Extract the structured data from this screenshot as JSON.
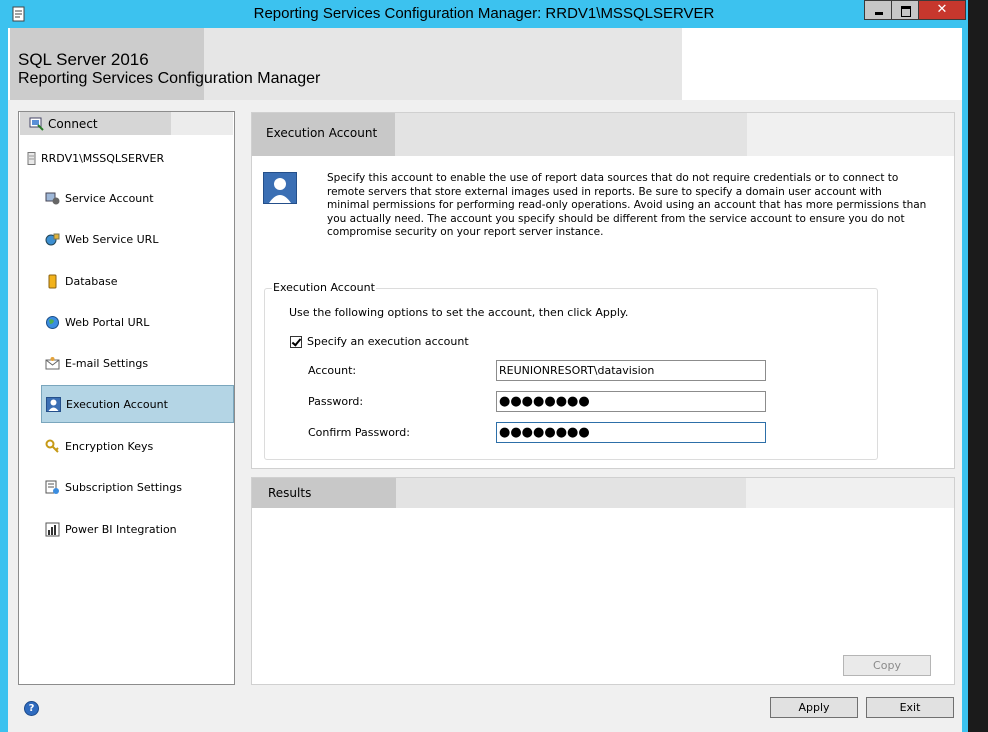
{
  "window": {
    "title": "Reporting Services Configuration Manager: RRDV1\\MSSQLSERVER",
    "close_label": "✕"
  },
  "banner": {
    "product": "SQL Server 2016",
    "app_name": "Reporting Services Configuration Manager"
  },
  "nav": {
    "connect_label": "Connect",
    "server": "RRDV1\\MSSQLSERVER",
    "items": [
      {
        "label": "Service Account",
        "icon": "service-account-icon"
      },
      {
        "label": "Web Service URL",
        "icon": "web-service-icon"
      },
      {
        "label": "Database",
        "icon": "database-icon"
      },
      {
        "label": "Web Portal URL",
        "icon": "globe-icon"
      },
      {
        "label": "E-mail Settings",
        "icon": "email-icon"
      },
      {
        "label": "Execution Account",
        "icon": "user-icon",
        "selected": true
      },
      {
        "label": "Encryption Keys",
        "icon": "key-icon"
      },
      {
        "label": "Subscription Settings",
        "icon": "subscription-icon"
      },
      {
        "label": "Power BI Integration",
        "icon": "powerbi-icon"
      }
    ]
  },
  "execution": {
    "title": "Execution Account",
    "description": "Specify this account to enable the use of report data sources that do not require credentials or to connect to remote servers that store external images used in reports. Be sure to specify a domain user account with minimal permissions for performing read-only operations. Avoid using an account that has more permissions than you actually need. The account you specify should be different from the service account to ensure you do not compromise security on your report server instance.",
    "group_label": "Execution Account",
    "hint": "Use the following options to set the account, then click Apply.",
    "checkbox_label": "Specify an execution account",
    "checkbox_checked": true,
    "account_label": "Account:",
    "account_value": "REUNIONRESORT\\datavision",
    "password_label": "Password:",
    "password_value": "●●●●●●●●",
    "confirm_label": "Confirm Password:",
    "confirm_value": "●●●●●●●●"
  },
  "results": {
    "title": "Results",
    "copy_label": "Copy"
  },
  "footer": {
    "apply_label": "Apply",
    "exit_label": "Exit",
    "help_glyph": "?"
  },
  "colors": {
    "titlebar": "#3cc2ef",
    "selected_nav": "#b4d5e5",
    "close_button": "#c7372d"
  }
}
